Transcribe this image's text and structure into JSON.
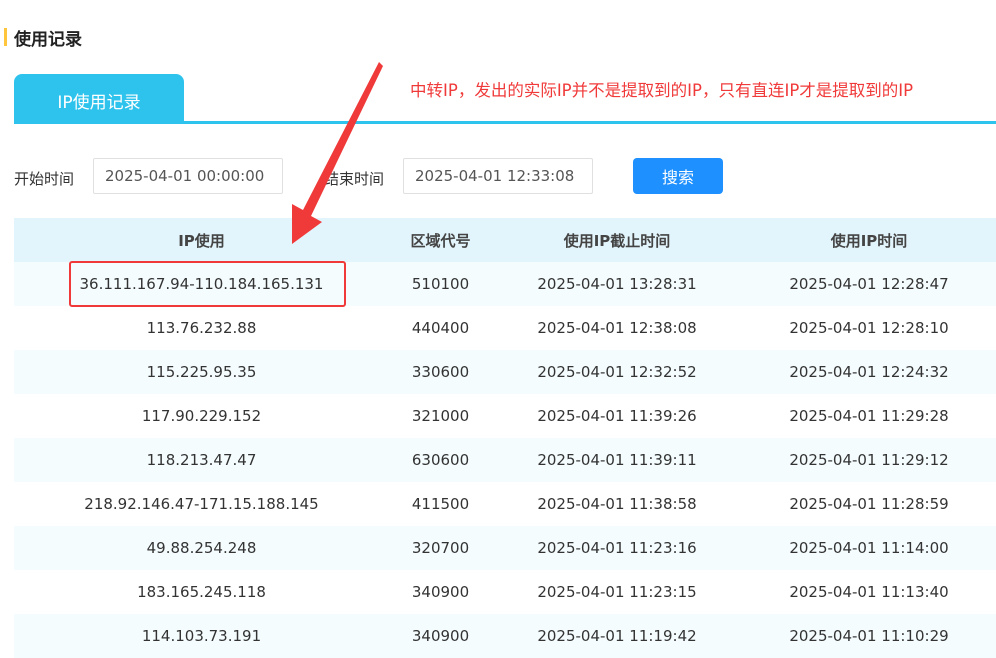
{
  "section": {
    "title": "使用记录",
    "accent_color": "#ffc53d"
  },
  "tabs": [
    {
      "label": "IP使用记录",
      "active": true
    }
  ],
  "annotation": {
    "text": "中转IP，发出的实际IP并不是提取到的IP，只有直连IP才是提取到的IP",
    "color": "#f03a3a"
  },
  "filters": {
    "start_label": "开始时间",
    "start_value": "2025-04-01 00:00:00",
    "end_label": "结束时间",
    "end_value": "2025-04-01 12:33:08",
    "search_label": "搜索"
  },
  "table": {
    "headers": [
      "IP使用",
      "区域代号",
      "使用IP截止时间",
      "使用IP时间"
    ],
    "rows": [
      [
        "36.111.167.94-110.184.165.131",
        "510100",
        "2025-04-01 13:28:31",
        "2025-04-01 12:28:47"
      ],
      [
        "113.76.232.88",
        "440400",
        "2025-04-01 12:38:08",
        "2025-04-01 12:28:10"
      ],
      [
        "115.225.95.35",
        "330600",
        "2025-04-01 12:32:52",
        "2025-04-01 12:24:32"
      ],
      [
        "117.90.229.152",
        "321000",
        "2025-04-01 11:39:26",
        "2025-04-01 11:29:28"
      ],
      [
        "118.213.47.47",
        "630600",
        "2025-04-01 11:39:11",
        "2025-04-01 11:29:12"
      ],
      [
        "218.92.146.47-171.15.188.145",
        "411500",
        "2025-04-01 11:38:58",
        "2025-04-01 11:28:59"
      ],
      [
        "49.88.254.248",
        "320700",
        "2025-04-01 11:23:16",
        "2025-04-01 11:14:00"
      ],
      [
        "183.165.245.118",
        "340900",
        "2025-04-01 11:23:15",
        "2025-04-01 11:13:40"
      ],
      [
        "114.103.73.191",
        "340900",
        "2025-04-01 11:19:42",
        "2025-04-01 11:10:29"
      ]
    ]
  },
  "colors": {
    "tab_accent": "#2ec3ec",
    "button": "#1e90ff",
    "header_bg": "#e3f5fc",
    "highlight": "#f03a3a"
  }
}
